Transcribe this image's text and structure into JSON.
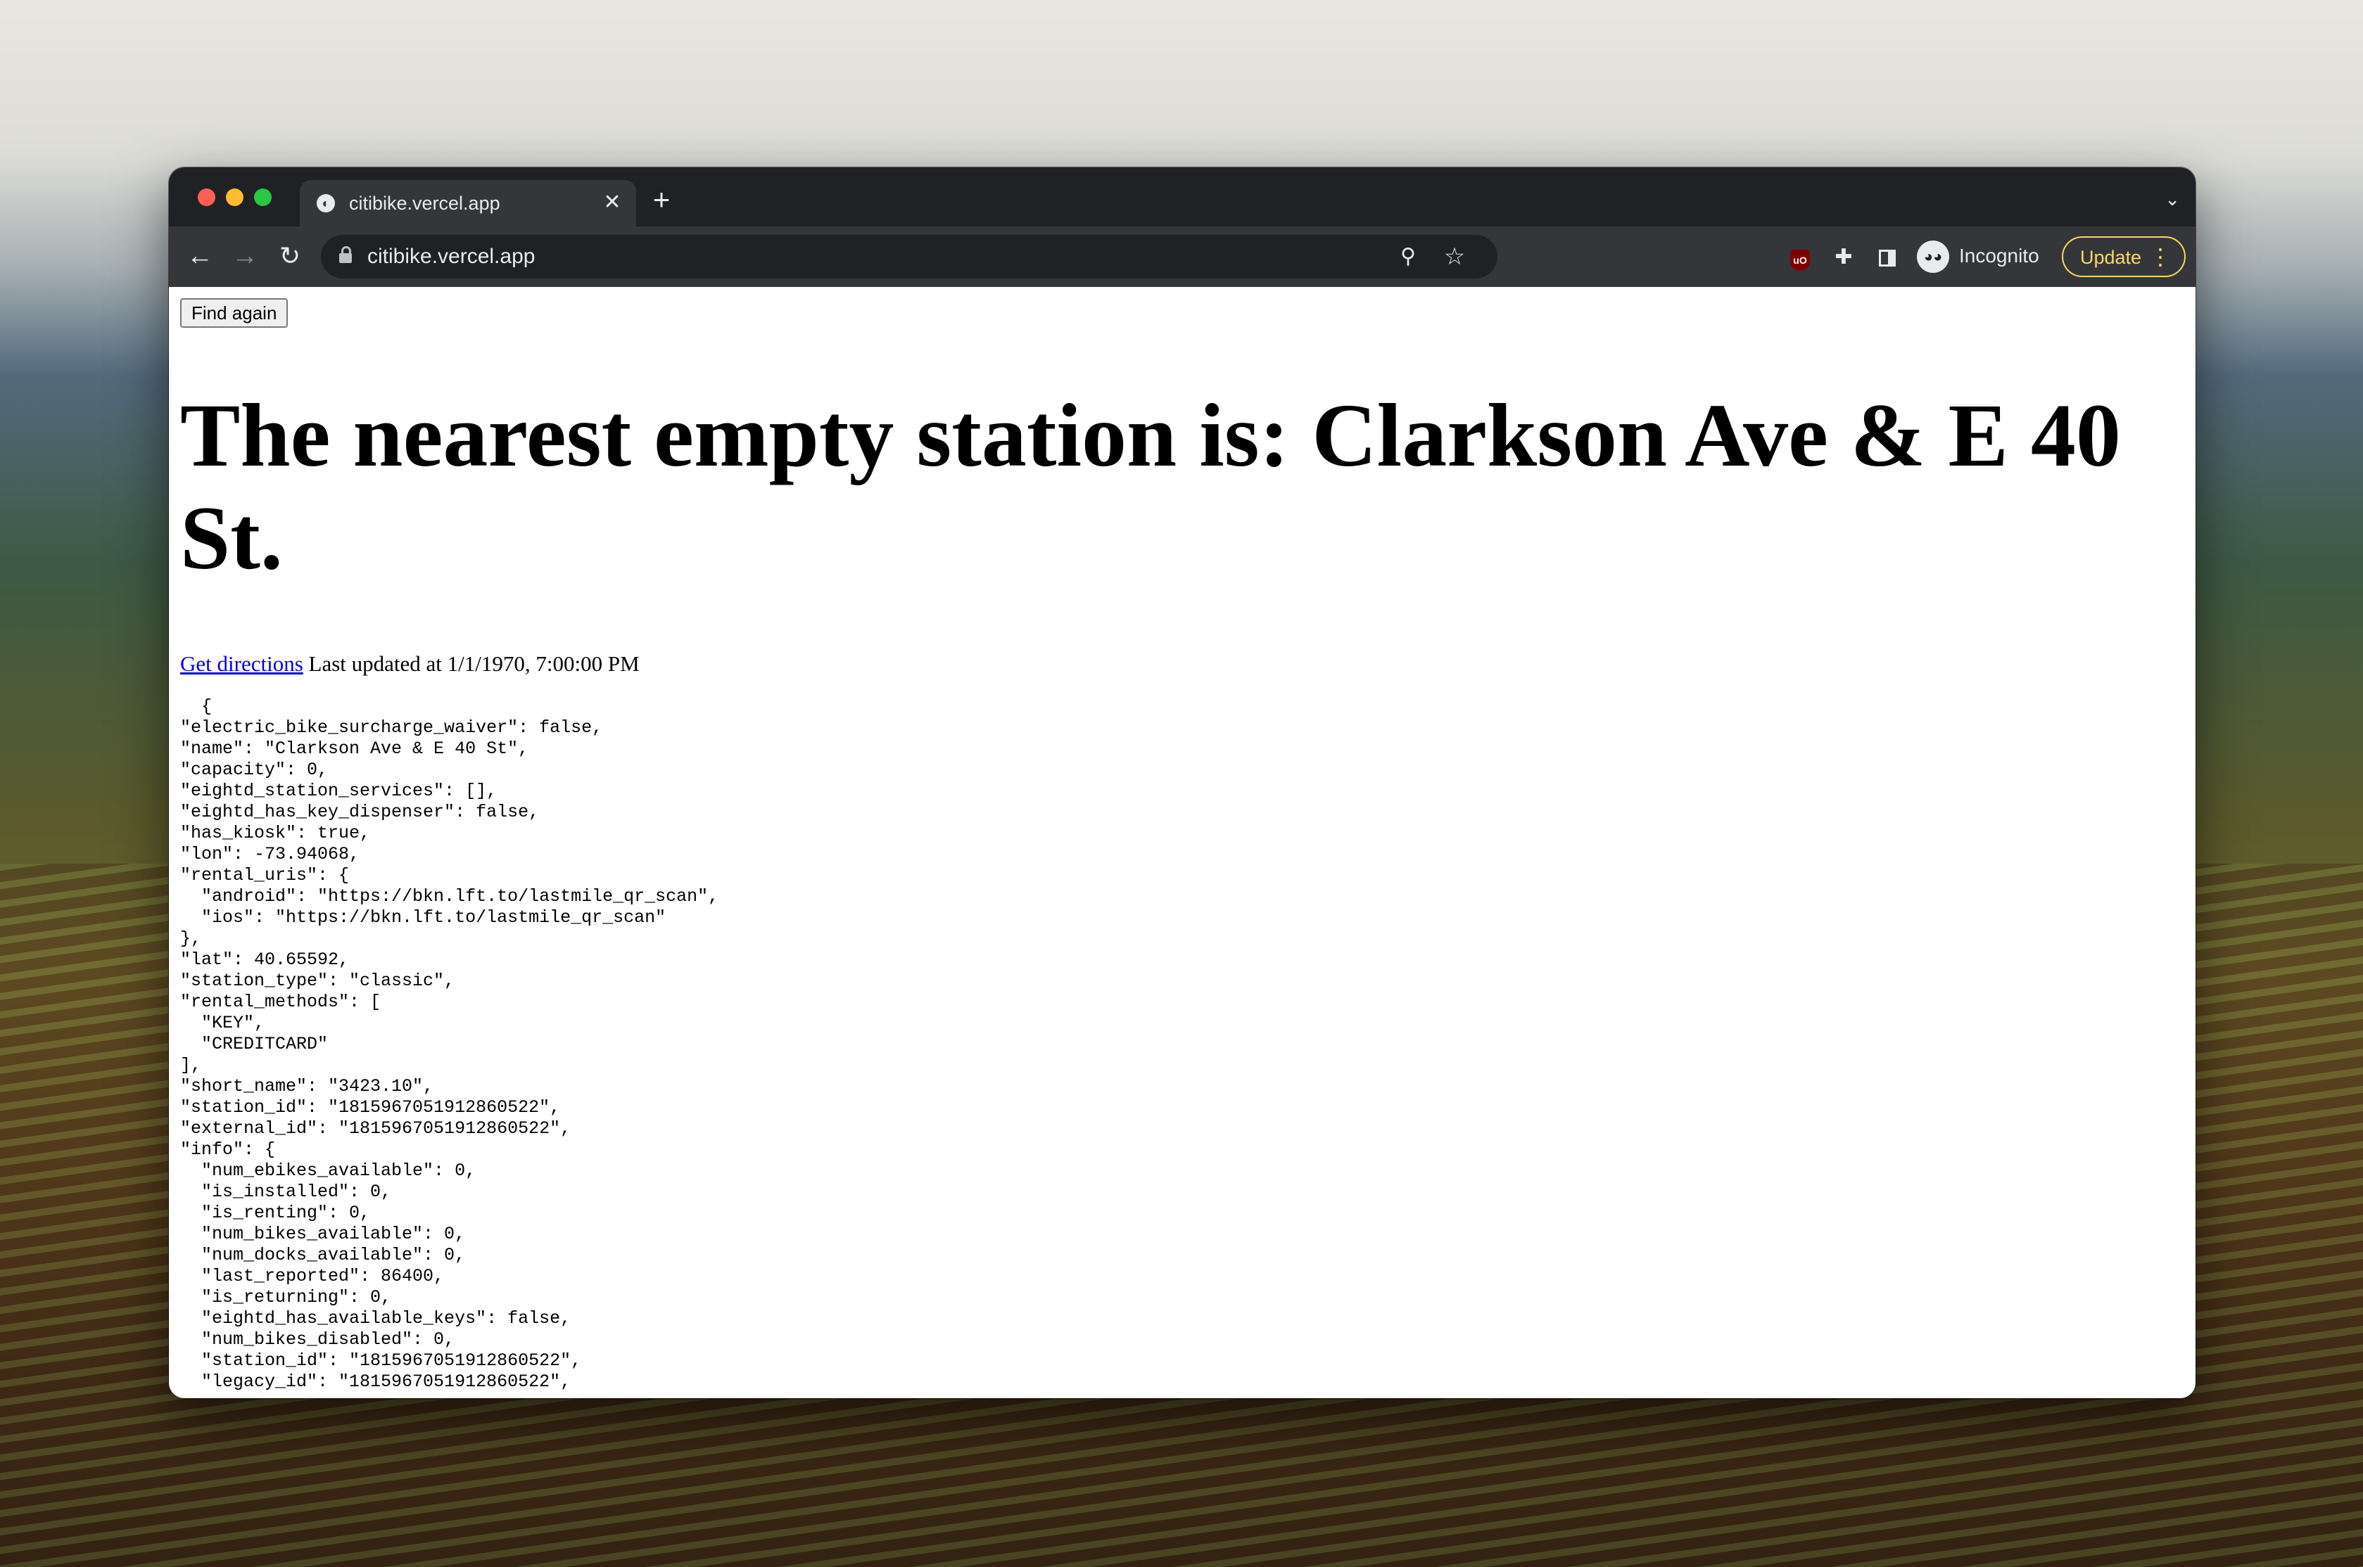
{
  "browser": {
    "tab_title": "citibike.vercel.app",
    "url": "citibike.vercel.app",
    "profile_label": "Incognito",
    "update_label": "Update"
  },
  "page": {
    "find_button_label": "Find again",
    "heading": "The nearest empty station is: Clarkson Ave & E 40 St.",
    "directions_link": "Get directions",
    "last_updated": "Last updated at 1/1/1970, 7:00:00 PM",
    "json_text": "  {\n\"electric_bike_surcharge_waiver\": false,\n\"name\": \"Clarkson Ave & E 40 St\",\n\"capacity\": 0,\n\"eightd_station_services\": [],\n\"eightd_has_key_dispenser\": false,\n\"has_kiosk\": true,\n\"lon\": -73.94068,\n\"rental_uris\": {\n  \"android\": \"https://bkn.lft.to/lastmile_qr_scan\",\n  \"ios\": \"https://bkn.lft.to/lastmile_qr_scan\"\n},\n\"lat\": 40.65592,\n\"station_type\": \"classic\",\n\"rental_methods\": [\n  \"KEY\",\n  \"CREDITCARD\"\n],\n\"short_name\": \"3423.10\",\n\"station_id\": \"1815967051912860522\",\n\"external_id\": \"1815967051912860522\",\n\"info\": {\n  \"num_ebikes_available\": 0,\n  \"is_installed\": 0,\n  \"is_renting\": 0,\n  \"num_bikes_available\": 0,\n  \"num_docks_available\": 0,\n  \"last_reported\": 86400,\n  \"is_returning\": 0,\n  \"eightd_has_available_keys\": false,\n  \"num_bikes_disabled\": 0,\n  \"station_id\": \"1815967051912860522\",\n  \"legacy_id\": \"1815967051912860522\","
  },
  "icons": {
    "tab_close": "close-icon",
    "new_tab": "plus-icon",
    "back": "arrow-left-icon",
    "forward": "arrow-right-icon",
    "reload": "reload-icon",
    "location": "location-pin-icon",
    "bookmark": "star-icon",
    "extension": "puzzle-icon",
    "side_panel": "side-panel-icon",
    "incognito": "incognito-icon"
  },
  "colors": {
    "tab_bar": "#202124",
    "toolbar": "#35363a",
    "link": "#0000ee",
    "update_accent": "#fdd663"
  }
}
